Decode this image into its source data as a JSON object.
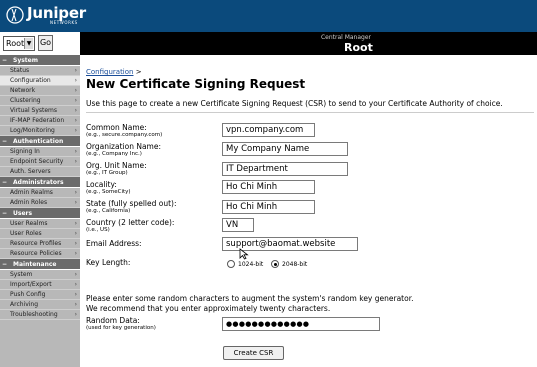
{
  "brand": {
    "name": "Juniper",
    "sub": "NETWORKS",
    "color": "#0b4a7c"
  },
  "header": {
    "role_value": "Root",
    "go_label": "Go",
    "cm_label": "Central Manager",
    "cm_title": "Root"
  },
  "sidebar": {
    "sections": [
      {
        "title": "System",
        "items": [
          "Status",
          "Configuration",
          "Network",
          "Clustering",
          "Virtual Systems",
          "IF-MAP Federation",
          "Log/Monitoring"
        ]
      },
      {
        "title": "Authentication",
        "items": [
          "Signing In",
          "Endpoint Security",
          "Auth. Servers"
        ]
      },
      {
        "title": "Administrators",
        "items": [
          "Admin Realms",
          "Admin Roles"
        ]
      },
      {
        "title": "Users",
        "items": [
          "User Realms",
          "User Roles",
          "Resource Profiles",
          "Resource Policies"
        ]
      },
      {
        "title": "Maintenance",
        "items": [
          "System",
          "Import/Export",
          "Push Config",
          "Archiving",
          "Troubleshooting"
        ]
      }
    ],
    "active_item": "Configuration"
  },
  "main": {
    "breadcrumb_link": "Configuration",
    "breadcrumb_sep": ">",
    "title": "New Certificate Signing Request",
    "intro": "Use this page to create a new Certificate Signing Request (CSR) to send to your Certificate Authority of choice.",
    "fields": {
      "common_name": {
        "label": "Common Name:",
        "hint": "(e.g., secure.company.com)",
        "value": "vpn.company.com"
      },
      "org_name": {
        "label": "Organization Name:",
        "hint": "(e.g., Company Inc.)",
        "value": "My Company Name"
      },
      "org_unit": {
        "label": "Org. Unit Name:",
        "hint": "(e.g., IT Group)",
        "value": "IT Department"
      },
      "locality": {
        "label": "Locality:",
        "hint": "(e.g., SomeCity)",
        "value": "Ho Chi Minh"
      },
      "state": {
        "label": "State (fully spelled out):",
        "hint": "(e.g., California)",
        "value": "Ho Chi Minh"
      },
      "country": {
        "label": "Country (2 letter code):",
        "hint": "(i.e., US)",
        "value": "VN"
      },
      "email": {
        "label": "Email Address:",
        "value": "support@baomat.website"
      }
    },
    "key_length": {
      "label": "Key Length:",
      "options": [
        "1024-bit",
        "2048-bit"
      ],
      "selected": "2048-bit"
    },
    "random_note_1": "Please enter some random characters to augment the system's random key generator.",
    "random_note_2": "We recommend that you enter approximately twenty characters.",
    "random": {
      "label": "Random Data:",
      "hint": "(used for key generation)",
      "value": "●●●●●●●●●●●●●"
    },
    "submit_label": "Create CSR"
  }
}
